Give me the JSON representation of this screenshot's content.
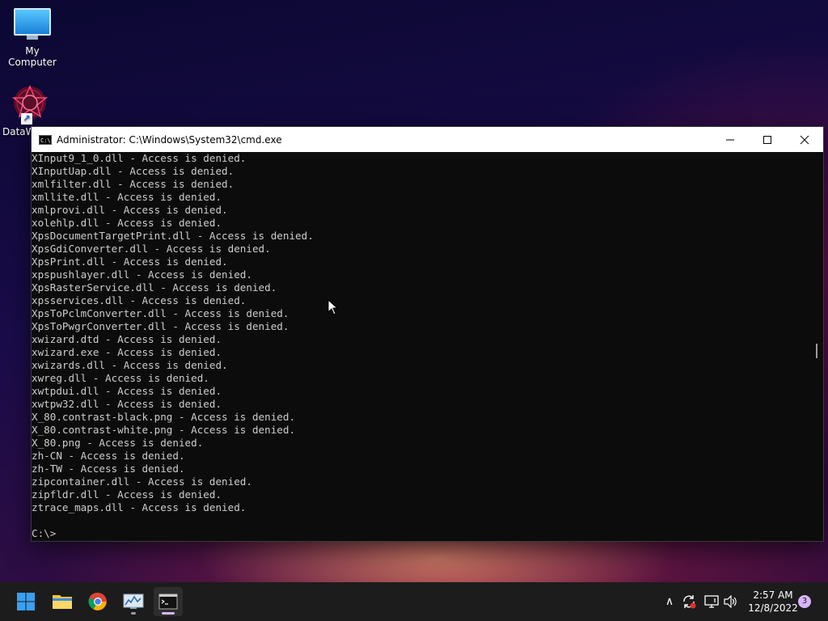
{
  "desktop": {
    "icons": [
      {
        "label": "My Computer"
      },
      {
        "label": "DataW"
      }
    ]
  },
  "window": {
    "title": "Administrator:  C:\\Windows\\System32\\cmd.exe",
    "app_icon_text": "C:\\",
    "minimize_glyph": "—",
    "maximize_glyph": "☐",
    "close_glyph": "✕"
  },
  "console": {
    "lines": [
      "XInput9_1_0.dll - Access is denied.",
      "XInputUap.dll - Access is denied.",
      "xmlfilter.dll - Access is denied.",
      "xmllite.dll - Access is denied.",
      "xmlprovi.dll - Access is denied.",
      "xolehlp.dll - Access is denied.",
      "XpsDocumentTargetPrint.dll - Access is denied.",
      "XpsGdiConverter.dll - Access is denied.",
      "XpsPrint.dll - Access is denied.",
      "xpspushlayer.dll - Access is denied.",
      "XpsRasterService.dll - Access is denied.",
      "xpsservices.dll - Access is denied.",
      "XpsToPclmConverter.dll - Access is denied.",
      "XpsToPwgrConverter.dll - Access is denied.",
      "xwizard.dtd - Access is denied.",
      "xwizard.exe - Access is denied.",
      "xwizards.dll - Access is denied.",
      "xwreg.dll - Access is denied.",
      "xwtpdui.dll - Access is denied.",
      "xwtpw32.dll - Access is denied.",
      "X_80.contrast-black.png - Access is denied.",
      "X_80.contrast-white.png - Access is denied.",
      "X_80.png - Access is denied.",
      "zh-CN - Access is denied.",
      "zh-TW - Access is denied.",
      "zipcontainer.dll - Access is denied.",
      "zipfldr.dll - Access is denied.",
      "ztrace_maps.dll - Access is denied.",
      "",
      "C:\\>"
    ]
  },
  "taskbar": {
    "items": [
      "start-icon",
      "file-explorer-icon",
      "chrome-icon",
      "resource-monitor-icon",
      "cmd-icon"
    ],
    "tray": {
      "chevron_glyph": "∧",
      "time": "2:57 AM",
      "date": "12/8/2022",
      "notification_count": "3"
    }
  },
  "colors": {
    "console_bg": "#0c0c0c",
    "console_fg": "#cccccc",
    "taskbar_bg": "#1c1c1c",
    "accent": "#d6b4ff"
  }
}
